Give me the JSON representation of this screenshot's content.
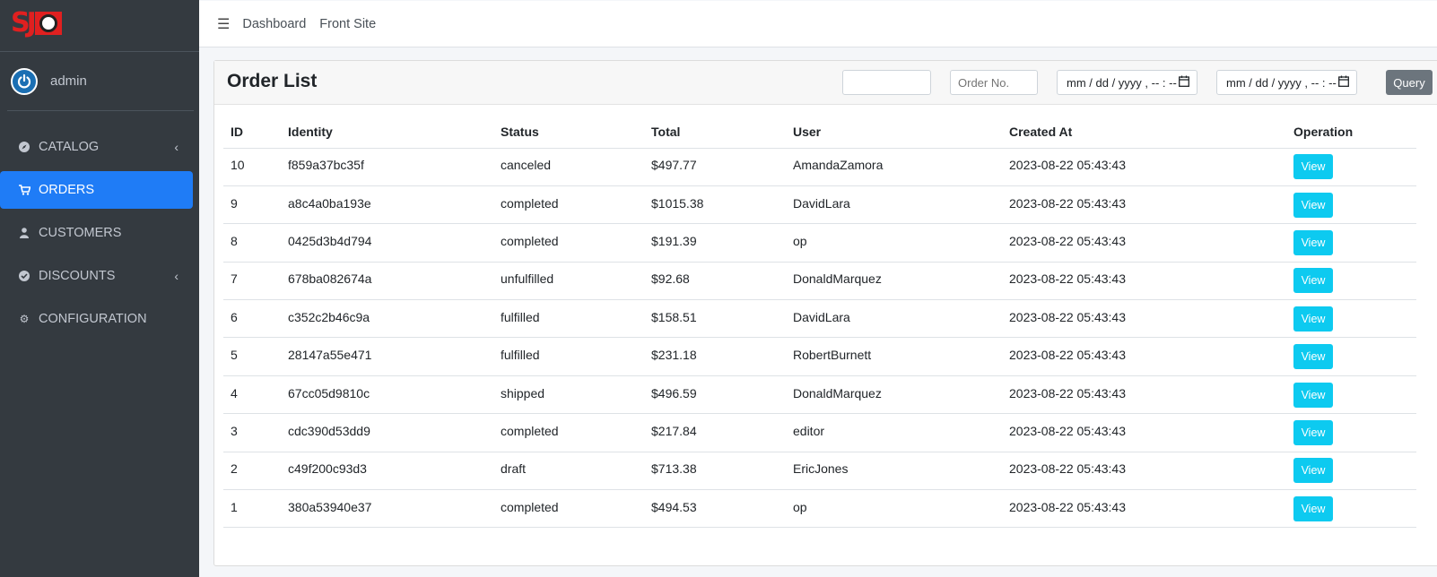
{
  "brand": {
    "logo_name": "store-logo"
  },
  "user": {
    "name": "admin"
  },
  "sidebar": {
    "items": [
      {
        "label": "CATALOG",
        "icon": "compass-icon",
        "has_chevron": true,
        "active": false
      },
      {
        "label": "ORDERS",
        "icon": "cart-icon",
        "has_chevron": false,
        "active": true
      },
      {
        "label": "CUSTOMERS",
        "icon": "user-icon",
        "has_chevron": false,
        "active": false
      },
      {
        "label": "DISCOUNTS",
        "icon": "check-circle-icon",
        "has_chevron": true,
        "active": false
      },
      {
        "label": "CONFIGURATION",
        "icon": "gear-icon",
        "has_chevron": false,
        "active": false
      }
    ]
  },
  "topnav": {
    "links": [
      "Dashboard",
      "Front Site"
    ]
  },
  "card": {
    "title": "Order List",
    "filters": {
      "identity_value": "",
      "order_no_placeholder": "Order No.",
      "date_from": "mm / dd / yyyy ,  -- : --",
      "date_to": "mm / dd / yyyy ,  -- : --",
      "query_label": "Query"
    }
  },
  "table": {
    "columns": [
      "ID",
      "Identity",
      "Status",
      "Total",
      "User",
      "Created At",
      "Operation"
    ],
    "rows": [
      {
        "id": "10",
        "identity": "f859a37bc35f",
        "status": "canceled",
        "total": "$497.77",
        "user": "AmandaZamora",
        "created_at": "2023-08-22 05:43:43",
        "action": "View"
      },
      {
        "id": "9",
        "identity": "a8c4a0ba193e",
        "status": "completed",
        "total": "$1015.38",
        "user": "DavidLara",
        "created_at": "2023-08-22 05:43:43",
        "action": "View"
      },
      {
        "id": "8",
        "identity": "0425d3b4d794",
        "status": "completed",
        "total": "$191.39",
        "user": "op",
        "created_at": "2023-08-22 05:43:43",
        "action": "View"
      },
      {
        "id": "7",
        "identity": "678ba082674a",
        "status": "unfulfilled",
        "total": "$92.68",
        "user": "DonaldMarquez",
        "created_at": "2023-08-22 05:43:43",
        "action": "View"
      },
      {
        "id": "6",
        "identity": "c352c2b46c9a",
        "status": "fulfilled",
        "total": "$158.51",
        "user": "DavidLara",
        "created_at": "2023-08-22 05:43:43",
        "action": "View"
      },
      {
        "id": "5",
        "identity": "28147a55e471",
        "status": "fulfilled",
        "total": "$231.18",
        "user": "RobertBurnett",
        "created_at": "2023-08-22 05:43:43",
        "action": "View"
      },
      {
        "id": "4",
        "identity": "67cc05d9810c",
        "status": "shipped",
        "total": "$496.59",
        "user": "DonaldMarquez",
        "created_at": "2023-08-22 05:43:43",
        "action": "View"
      },
      {
        "id": "3",
        "identity": "cdc390d53dd9",
        "status": "completed",
        "total": "$217.84",
        "user": "editor",
        "created_at": "2023-08-22 05:43:43",
        "action": "View"
      },
      {
        "id": "2",
        "identity": "c49f200c93d3",
        "status": "draft",
        "total": "$713.38",
        "user": "EricJones",
        "created_at": "2023-08-22 05:43:43",
        "action": "View"
      },
      {
        "id": "1",
        "identity": "380a53940e37",
        "status": "completed",
        "total": "$494.53",
        "user": "op",
        "created_at": "2023-08-22 05:43:43",
        "action": "View"
      }
    ]
  },
  "colors": {
    "sidebar_bg": "#343a40",
    "active": "#1f7cf6",
    "view_button": "#0dcaf0",
    "query_button": "#6c757d"
  }
}
